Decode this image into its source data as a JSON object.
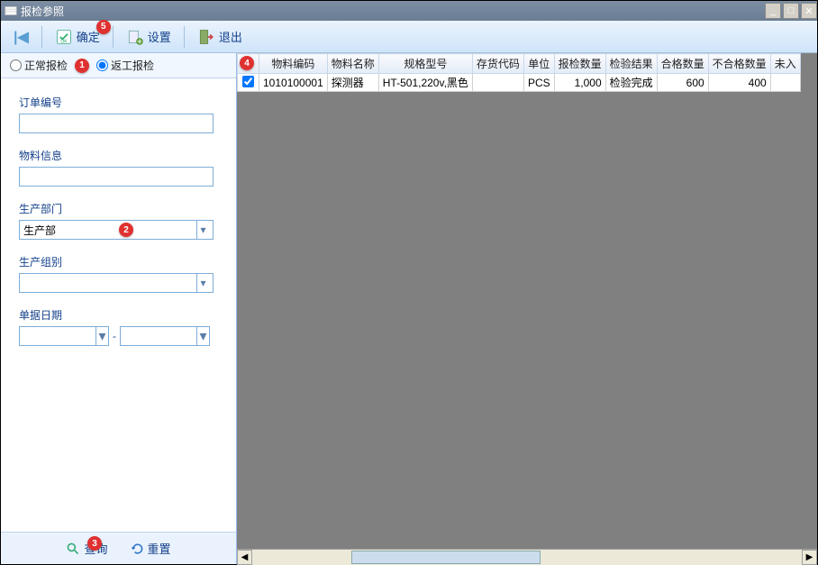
{
  "window": {
    "title": "报检参照"
  },
  "toolbar": {
    "confirm": "确定",
    "settings": "设置",
    "exit": "退出"
  },
  "radios": {
    "normal": "正常报检",
    "rework": "返工报检"
  },
  "form": {
    "order_no": {
      "label": "订单编号",
      "value": ""
    },
    "material": {
      "label": "物料信息",
      "value": ""
    },
    "dept": {
      "label": "生产部门",
      "value": "生产部"
    },
    "group": {
      "label": "生产组别",
      "value": ""
    },
    "date": {
      "label": "单据日期",
      "from": "",
      "to": "",
      "sep": "-"
    }
  },
  "bottom": {
    "query": "查询",
    "reset": "重置"
  },
  "grid": {
    "headers": [
      "物料编码",
      "物料名称",
      "规格型号",
      "存货代码",
      "单位",
      "报检数量",
      "检验结果",
      "合格数量",
      "不合格数量",
      "未入"
    ],
    "row": {
      "checked": true,
      "code": "1010100001",
      "name": "探测器",
      "spec": "HT-501,220v,黑色",
      "stockcode": "",
      "unit": "PCS",
      "qty": "1,000",
      "result": "检验完成",
      "ok": "600",
      "ng": "400"
    }
  },
  "markers": {
    "m1": "1",
    "m2": "2",
    "m3": "3",
    "m4": "4",
    "m5": "5"
  }
}
